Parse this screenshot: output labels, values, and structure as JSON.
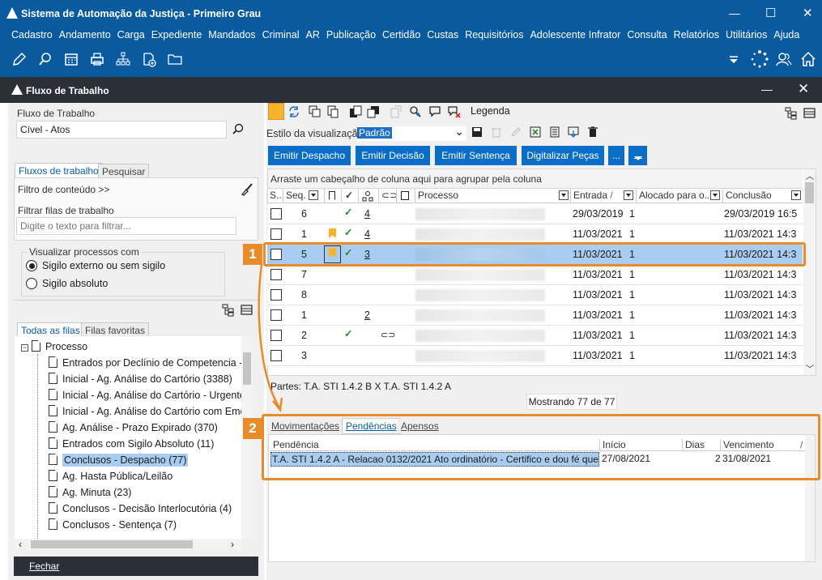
{
  "window": {
    "title": "Sistema de Automação da Justiça - Primeiro Grau",
    "min": "—",
    "max": "☐",
    "close": "✕"
  },
  "menu": [
    "Cadastro",
    "Andamento",
    "Carga",
    "Expediente",
    "Mandados",
    "Criminal",
    "AR",
    "Publicação",
    "Certidão",
    "Custas",
    "Requisitórios",
    "Adolescente Infrator",
    "Consulta",
    "Relatórios",
    "Utilitários",
    "Ajuda"
  ],
  "flux_window": {
    "title": "Fluxo de Trabalho",
    "min": "—",
    "close": "✕"
  },
  "left": {
    "fluxo_label": "Fluxo de Trabalho",
    "fluxo_value": "Cível - Atos",
    "tabs": [
      "Fluxos de trabalho",
      "Pesquisar"
    ],
    "filtro_conteudo": "Filtro de conteúdo >>",
    "filtrar_label": "Filtrar filas de trabalho",
    "filtrar_placeholder": "Digite o texto para filtrar...",
    "visualizar_label": "Visualizar processos com",
    "radio1": "Sigilo externo ou sem sigilo",
    "radio2": "Sigilo absoluto",
    "queue_tabs": [
      "Todas as filas",
      "Filas favoritas"
    ],
    "tree_root": "Processo",
    "tree": [
      "Entrados por Declínio de Competencia - T",
      "Inicial - Ag. Análise do Cartório (3388)",
      "Inicial - Ag. Análise do Cartório - Urgente",
      "Inicial - Ag. Análise do Cartório com Emer",
      "Ag. Análise - Prazo Expirado (370)",
      "Entrados com Sigilo Absoluto (11)",
      "Conclusos - Despacho (77)",
      "Ag. Hasta Pública/Leilão",
      "Ag. Minuta (23)",
      "Conclusos - Decisão Interlocutória (4)",
      "Conclusos - Sentença (7)"
    ],
    "selected_tree_index": 6,
    "fechar": "Fechar"
  },
  "right": {
    "legenda": "Legenda",
    "estilo_label": "Estilo da visualização",
    "estilo_value": "Padrão",
    "buttons": [
      "Emitir Despacho",
      "Emitir Decisão",
      "Emitir Sentença",
      "Digitalizar Peças",
      "..."
    ],
    "group_hint": "Arraste um cabeçalho de coluna aqui para agrupar pela coluna",
    "columns": [
      "S...",
      "Seq.",
      "Processo",
      "Entrada",
      "Alocado para o...",
      "Conclusão"
    ],
    "rows": [
      {
        "seq": "6",
        "flag": false,
        "check": true,
        "link": "4",
        "entrada": "29/03/2019",
        "alocado": "1",
        "conclusao": "29/03/2019 16:5"
      },
      {
        "seq": "1",
        "flag": true,
        "check": true,
        "link": "4",
        "entrada": "11/03/2021",
        "alocado": "1",
        "conclusao": "11/03/2021 14:3"
      },
      {
        "seq": "5",
        "flag": true,
        "check": true,
        "link": "3",
        "entrada": "11/03/2021",
        "alocado": "1",
        "conclusao": "11/03/2021 14:3"
      },
      {
        "seq": "7",
        "flag": false,
        "check": false,
        "link": "",
        "entrada": "11/03/2021",
        "alocado": "1",
        "conclusao": "11/03/2021 14:3"
      },
      {
        "seq": "8",
        "flag": false,
        "check": false,
        "link": "",
        "entrada": "11/03/2021",
        "alocado": "1",
        "conclusao": "11/03/2021 14:3"
      },
      {
        "seq": "1",
        "flag": false,
        "check": false,
        "link": "2",
        "entrada": "11/03/2021",
        "alocado": "1",
        "conclusao": "11/03/2021 14:3"
      },
      {
        "seq": "2",
        "flag": false,
        "check": true,
        "link": "",
        "entrada": "11/03/2021",
        "alocado": "1",
        "conclusao": "11/03/2021 14:3"
      },
      {
        "seq": "3",
        "flag": false,
        "check": false,
        "link": "",
        "entrada": "11/03/2021",
        "alocado": "1",
        "conclusao": "11/03/2021 14:3"
      }
    ],
    "partes": "Partes: T.A. STI 1.4.2 B  X  T.A. STI 1.4.2 A",
    "mostrando": "Mostrando 77 de 77",
    "detail_tabs": [
      "Movimentações",
      "Pendências",
      "Apensos"
    ],
    "pend_columns": [
      "Pendência",
      "Início",
      "Dias",
      "Vencimento"
    ],
    "pend_row": {
      "pendencia": "T.A. STI 1.4.2 A - Relacao 0132/2021 Ato ordinatório - Certifico e dou fé que, nos t",
      "inicio": "27/08/2021",
      "dias": "2",
      "vencimento": "31/08/2021"
    },
    "callout1": "1",
    "callout2": "2"
  },
  "colors": {
    "primary": "#0a5aa0",
    "dark_bar": "#2b2f36",
    "accent": "#e88b2a",
    "selection": "#a9cdf0"
  }
}
